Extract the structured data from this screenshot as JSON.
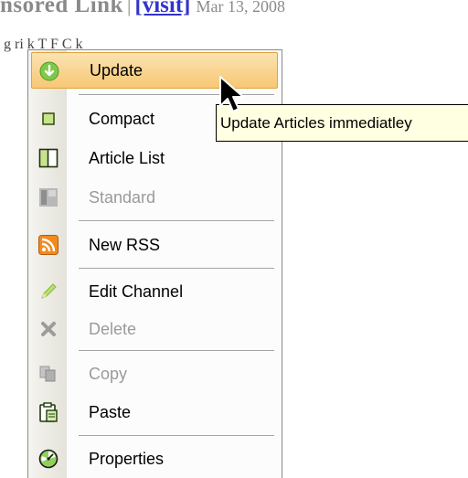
{
  "background": {
    "sponsored_text": "nsored Link",
    "separator": "|",
    "visit_link": "[visit]",
    "date": "Mar 13, 2008",
    "line2_text": "g ri   k  T  F  C  k"
  },
  "menu": {
    "items": [
      {
        "label": "Update",
        "icon": "update-icon",
        "disabled": false,
        "highlighted": true
      },
      {
        "label": "Compact",
        "icon": "compact-view-icon",
        "disabled": false
      },
      {
        "label": "Article List",
        "icon": "article-list-view-icon",
        "disabled": false
      },
      {
        "label": "Standard",
        "icon": "standard-view-icon",
        "disabled": true
      },
      {
        "label": "New RSS",
        "icon": "rss-feed-icon",
        "disabled": false
      },
      {
        "label": "Edit Channel",
        "icon": "pencil-icon",
        "disabled": false
      },
      {
        "label": "Delete",
        "icon": "delete-x-icon",
        "disabled": true
      },
      {
        "label": "Copy",
        "icon": "copy-icon",
        "disabled": true
      },
      {
        "label": "Paste",
        "icon": "clipboard-paste-icon",
        "disabled": false
      },
      {
        "label": "Properties",
        "icon": "properties-gauge-icon",
        "disabled": false
      }
    ]
  },
  "tooltip": {
    "text": "Update Articles immediatley"
  },
  "colors": {
    "highlight_top": "#fbe3b1",
    "highlight_bottom": "#f7c774",
    "tooltip_bg": "#ffffe1",
    "disabled_text": "#9a9a9a",
    "link": "#3333cc"
  }
}
